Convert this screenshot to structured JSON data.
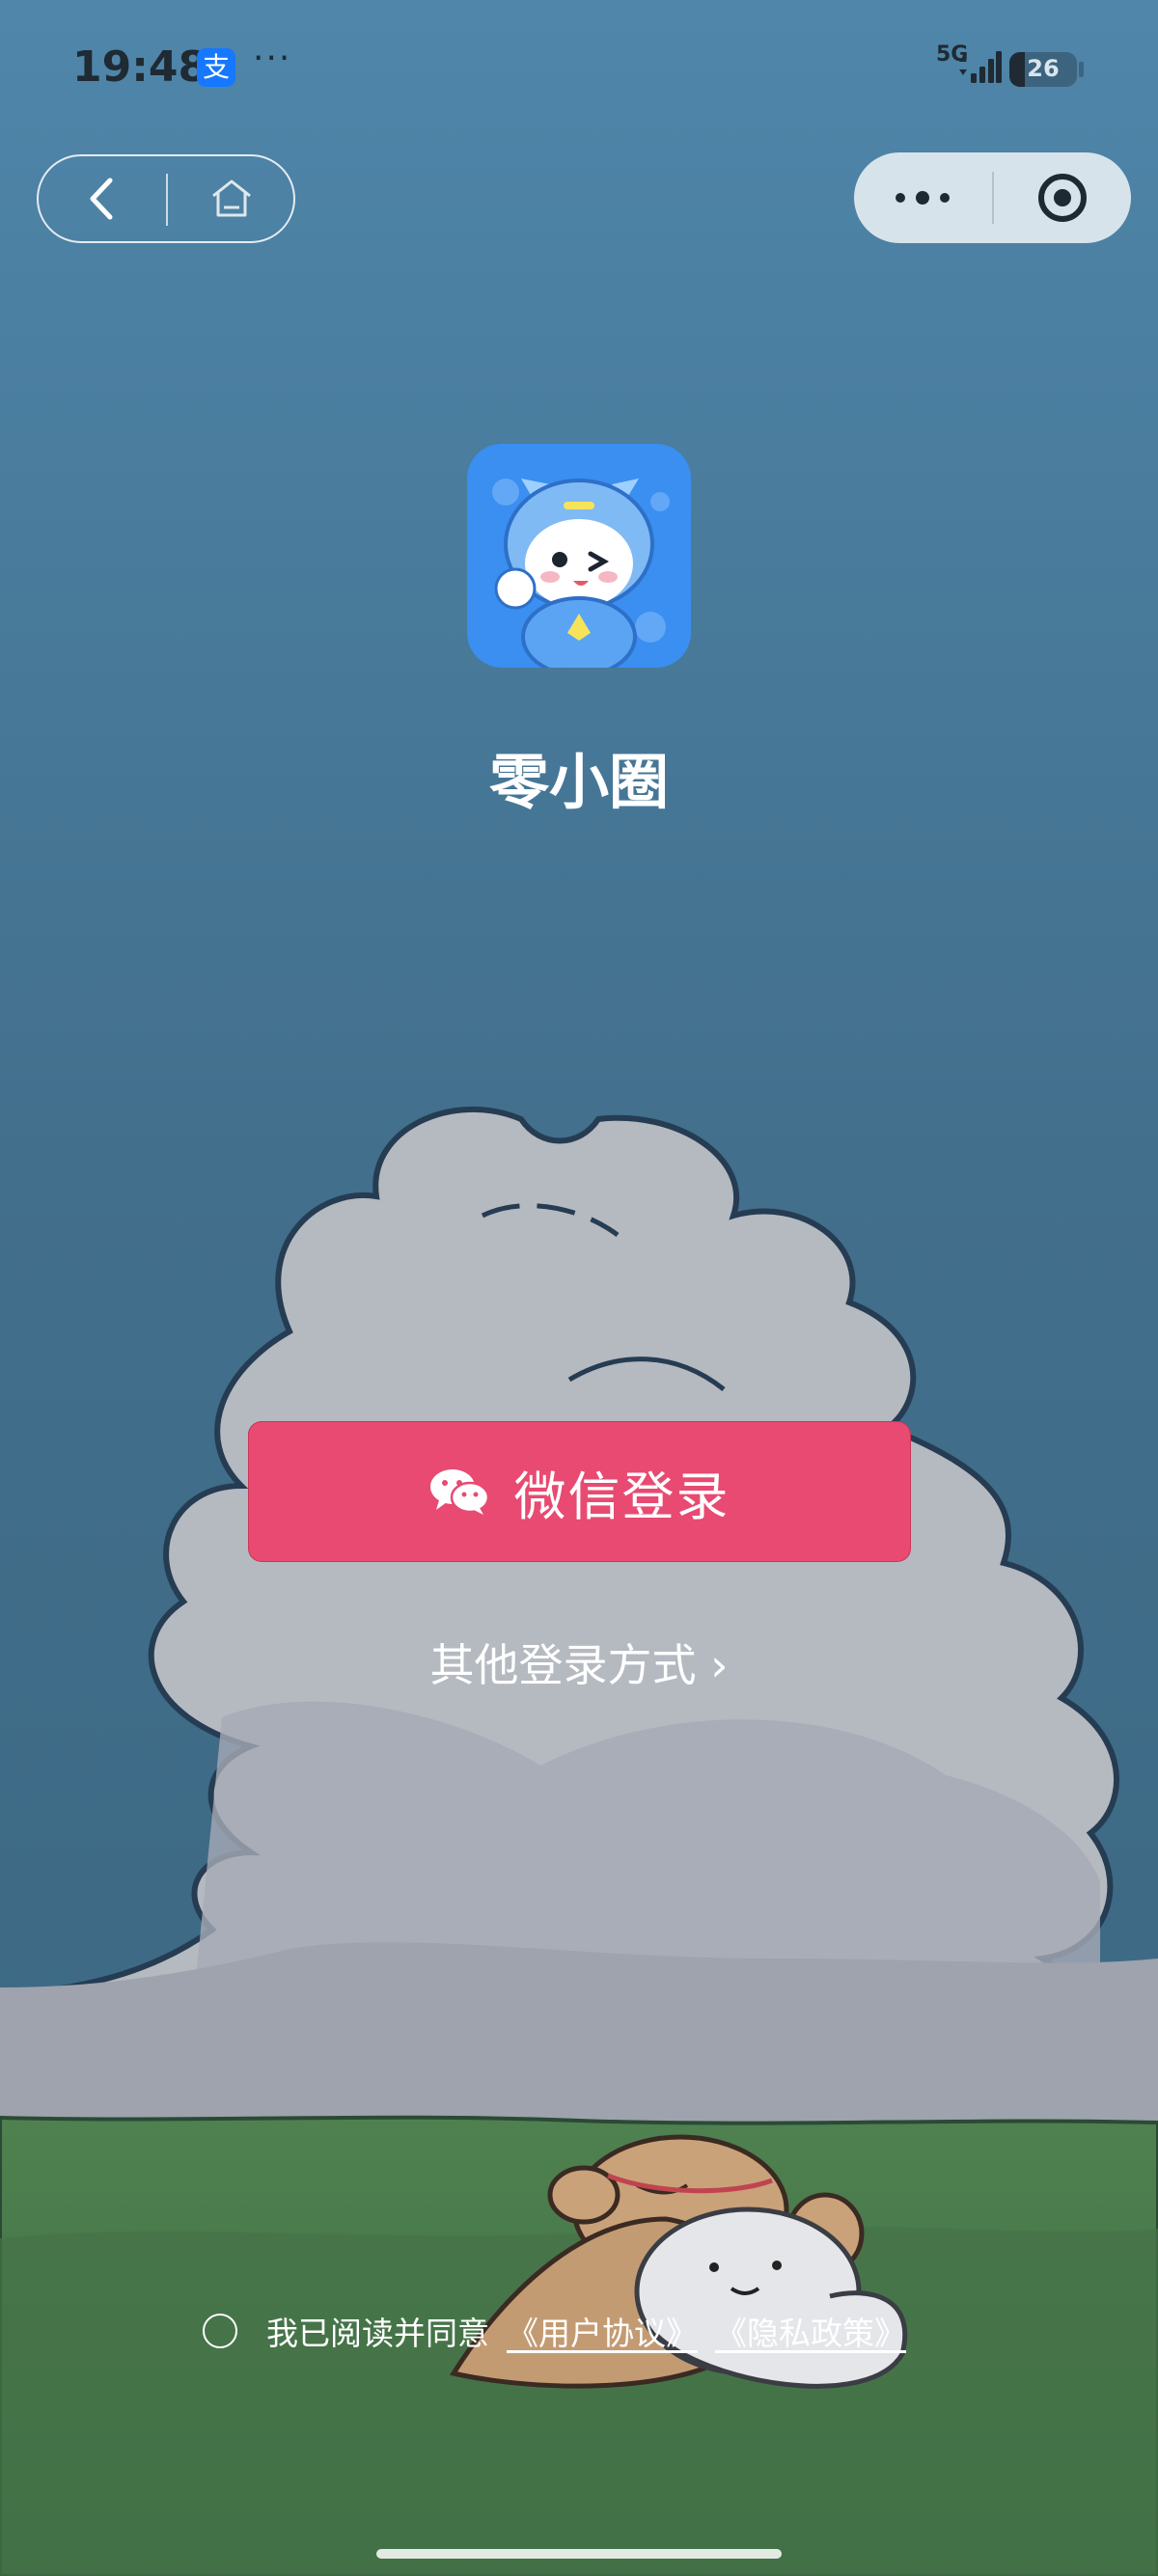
{
  "status_bar": {
    "time": "19:48",
    "app_badge": "支",
    "more_dots": "···",
    "network": "5G",
    "battery": "26"
  },
  "app": {
    "name": "零小圈"
  },
  "login": {
    "wechat_label": "微信登录",
    "other_label": "其他登录方式 ›"
  },
  "agreement": {
    "prefix": "我已阅读并同意",
    "user_agreement": "《用户协议》",
    "privacy_policy": "《隐私政策》"
  },
  "colors": {
    "primary_button": "#e84a72",
    "sky_top": "#4f86aa",
    "sky_bottom": "#3e6f8c",
    "grass": "#4b7a4d"
  },
  "icons": {
    "back": "chevron-left-icon",
    "home": "home-icon",
    "more": "more-dots-icon",
    "close": "target-close-icon",
    "wechat": "wechat-icon"
  }
}
